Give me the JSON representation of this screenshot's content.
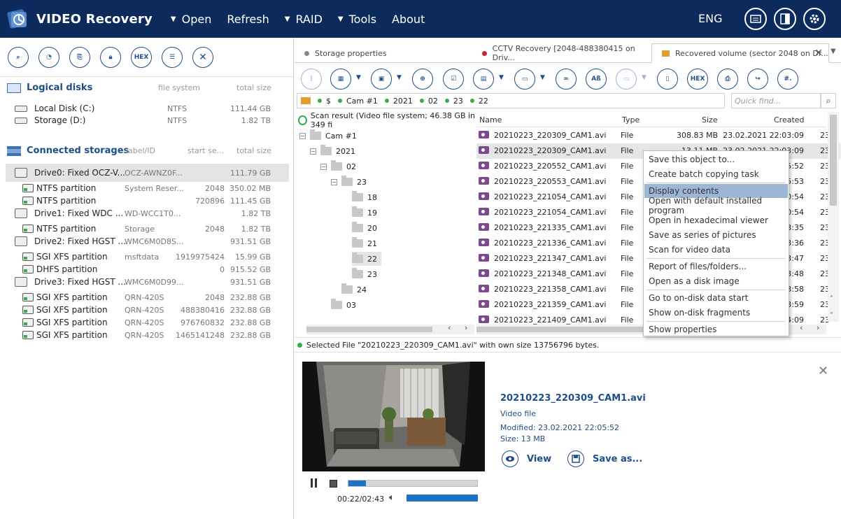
{
  "app": {
    "title": "VIDEO Recovery",
    "menu": [
      {
        "label": "Open",
        "caret": true
      },
      {
        "label": "Refresh",
        "caret": false
      },
      {
        "label": "RAID",
        "caret": true
      },
      {
        "label": "Tools",
        "caret": true
      },
      {
        "label": "About",
        "caret": false
      }
    ],
    "language": "ENG"
  },
  "left": {
    "toolbar_hex": "HEX",
    "logical_disks": {
      "title": "Logical disks",
      "col_fs": "file system",
      "col_size": "total size",
      "items": [
        {
          "name": "Local Disk (C:)",
          "fs": "NTFS",
          "size": "111.44 GB"
        },
        {
          "name": "Storage (D:)",
          "fs": "NTFS",
          "size": "1.82 TB"
        }
      ]
    },
    "connected": {
      "title": "Connected storages",
      "col_label": "label/ID",
      "col_start": "start se...",
      "col_size": "total size",
      "rows": [
        {
          "type": "drive",
          "name": "Drive0: Fixed OCZ-V...",
          "label": "OCZ-AWNZ0F...",
          "start": "",
          "size": "111.79 GB",
          "selected": true
        },
        {
          "type": "part",
          "name": "NTFS partition",
          "label": "System Reser...",
          "start": "2048",
          "size": "350.02 MB"
        },
        {
          "type": "part",
          "name": "NTFS partition",
          "label": "",
          "start": "720896",
          "size": "111.45 GB"
        },
        {
          "type": "drive",
          "name": "Drive1: Fixed WDC ...",
          "label": "WD-WCC1T0...",
          "start": "",
          "size": "1.82 TB"
        },
        {
          "type": "part",
          "name": "NTFS partition",
          "label": "Storage",
          "start": "2048",
          "size": "1.82 TB"
        },
        {
          "type": "drive",
          "name": "Drive2: Fixed HGST ...",
          "label": "WMC6M0D8S...",
          "start": "",
          "size": "931.51 GB"
        },
        {
          "type": "part",
          "name": "SGI XFS partition",
          "label": "msftdata",
          "start": "1919975424",
          "size": "15.99 GB"
        },
        {
          "type": "part",
          "name": "DHFS partition",
          "label": "",
          "start": "0",
          "size": "915.52 GB"
        },
        {
          "type": "drive",
          "name": "Drive3: Fixed HGST ...",
          "label": "WMC6M0D99...",
          "start": "",
          "size": "931.51 GB"
        },
        {
          "type": "part",
          "name": "SGI XFS partition",
          "label": "QRN-420S",
          "start": "2048",
          "size": "232.88 GB"
        },
        {
          "type": "part",
          "name": "SGI XFS partition",
          "label": "QRN-420S",
          "start": "488380416",
          "size": "232.88 GB"
        },
        {
          "type": "part",
          "name": "SGI XFS partition",
          "label": "QRN-420S",
          "start": "976760832",
          "size": "232.88 GB"
        },
        {
          "type": "part",
          "name": "SGI XFS partition",
          "label": "QRN-420S",
          "start": "1465141248",
          "size": "232.88 GB"
        }
      ]
    }
  },
  "tabs": [
    {
      "label": "Storage properties",
      "dot": "#888888"
    },
    {
      "label": "CCTV Recovery [2048-488380415 on Driv...",
      "dot": "#c0282d"
    },
    {
      "label": "Recovered volume (sector 2048 on Dr...",
      "dot": "folder"
    }
  ],
  "toolbar": {
    "hex": "HEX",
    "ab": "Aß",
    "hash": "#."
  },
  "path": {
    "segments": [
      "$",
      "Cam #1",
      "2021",
      "02",
      "23",
      "22"
    ],
    "quick_find_placeholder": "Quick find..."
  },
  "tree": {
    "root": "Scan result (Video file system; 46.38 GB in 349 fi",
    "nodes": [
      "Cam #1",
      "2021",
      "02",
      "23",
      "18",
      "19",
      "20",
      "21",
      "22",
      "23",
      "24",
      "03"
    ]
  },
  "files": {
    "columns": [
      "Name",
      "Type",
      "Size",
      "Created"
    ],
    "rows": [
      {
        "name": "20210223_220309_CAM1.avi",
        "type": "File",
        "size": "308.83 MB",
        "created": "23.02.2021 22:03:09",
        "extra": "23"
      },
      {
        "name": "20210223_220309_CAM1.avi",
        "type": "File",
        "size": "13.11 MB",
        "created": "23.02.2021 22:03:09",
        "extra": "23",
        "selected": true
      },
      {
        "name": "20210223_220552_CAM1.avi",
        "type": "File",
        "size": "",
        "created": "5:52",
        "extra": "23"
      },
      {
        "name": "20210223_220553_CAM1.avi",
        "type": "File",
        "size": "",
        "created": "5:53",
        "extra": "23"
      },
      {
        "name": "20210223_221054_CAM1.avi",
        "type": "File",
        "size": "",
        "created": "0:54",
        "extra": "23"
      },
      {
        "name": "20210223_221054_CAM1.avi",
        "type": "File",
        "size": "",
        "created": "0:54",
        "extra": "23"
      },
      {
        "name": "20210223_221335_CAM1.avi",
        "type": "File",
        "size": "",
        "created": "3:35",
        "extra": "23"
      },
      {
        "name": "20210223_221336_CAM1.avi",
        "type": "File",
        "size": "",
        "created": "3:36",
        "extra": "23"
      },
      {
        "name": "20210223_221347_CAM1.avi",
        "type": "File",
        "size": "",
        "created": "3:47",
        "extra": "23"
      },
      {
        "name": "20210223_221348_CAM1.avi",
        "type": "File",
        "size": "",
        "created": "3:48",
        "extra": "23"
      },
      {
        "name": "20210223_221358_CAM1.avi",
        "type": "File",
        "size": "",
        "created": "3:58",
        "extra": "23"
      },
      {
        "name": "20210223_221359_CAM1.avi",
        "type": "File",
        "size": "",
        "created": "3:59",
        "extra": "23"
      },
      {
        "name": "20210223_221409_CAM1.avi",
        "type": "File",
        "size": "",
        "created": "4:09",
        "extra": "23"
      }
    ]
  },
  "context_menu": {
    "groups": [
      [
        "Save this object to...",
        "Create batch copying task"
      ],
      [
        "Display contents",
        "Open with default installed program",
        "Open in hexadecimal viewer",
        "Save as series of pictures",
        "Scan for video data"
      ],
      [
        "Report of files/folders...",
        "Open as a disk image"
      ],
      [
        "Go to on-disk data start",
        "Show on-disk fragments"
      ],
      [
        "Show properties"
      ]
    ],
    "highlighted": "Display contents"
  },
  "status": "Selected File \"20210223_220309_CAM1.avi\" with own size 13756796 bytes.",
  "preview": {
    "file_name": "20210223_220309_CAM1.avi",
    "file_type": "Video file",
    "modified": "Modified: 23.02.2021 22:05:52",
    "size": "Size: 13 MB",
    "view_label": "View",
    "save_label": "Save as...",
    "time": "00:22/02:43",
    "progress_fraction": 0.135,
    "volume_fraction": 1.0
  },
  "colors": {
    "titlebar": "#0c2b5c",
    "accent": "#1f4e87",
    "highlight": "#9cb6d6",
    "green": "#2fb04a"
  }
}
